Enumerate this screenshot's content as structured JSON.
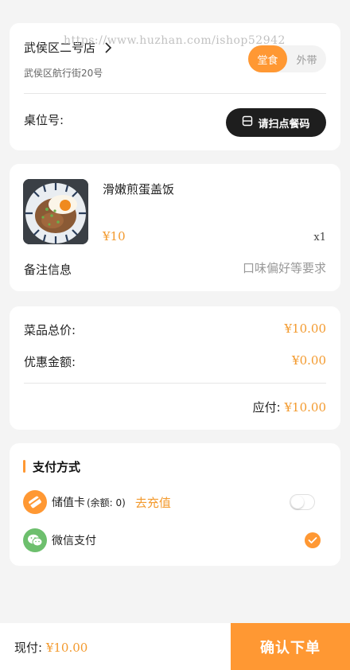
{
  "store": {
    "name": "武侯区二号店",
    "address": "武侯区航行街20号",
    "watermark": "https://www.huzhan.com/ishop52942",
    "modes": [
      "堂食",
      "外带"
    ],
    "active_mode": "堂食",
    "table_label": "桌位号:",
    "scan_button": "请扫点餐码"
  },
  "item": {
    "name": "滑嫩煎蛋盖饭",
    "price": "¥10",
    "qty": "x1",
    "note_label": "备注信息",
    "note_placeholder": "口味偏好等要求"
  },
  "totals": {
    "subtotal_label": "菜品总价:",
    "subtotal_value": "¥10.00",
    "discount_label": "优惠金额:",
    "discount_value": "¥0.00",
    "payable_label": "应付:",
    "payable_value": "¥10.00"
  },
  "payment": {
    "title": "支付方式",
    "methods": [
      {
        "name": "储值卡",
        "sub": "(余额: 0)",
        "action": "去充值",
        "icon": "card-icon",
        "icon_color": "#ff9833",
        "selected": false
      },
      {
        "name": "微信支付",
        "icon": "wechat-icon",
        "icon_color": "#6dbf6d",
        "selected": true
      }
    ]
  },
  "footer": {
    "cash_label": "现付:",
    "cash_value": "¥10.00",
    "confirm_button": "确认下单"
  },
  "colors": {
    "accent": "#ff9833",
    "price": "#f39a2e",
    "dark_button": "#1e1e1e"
  }
}
